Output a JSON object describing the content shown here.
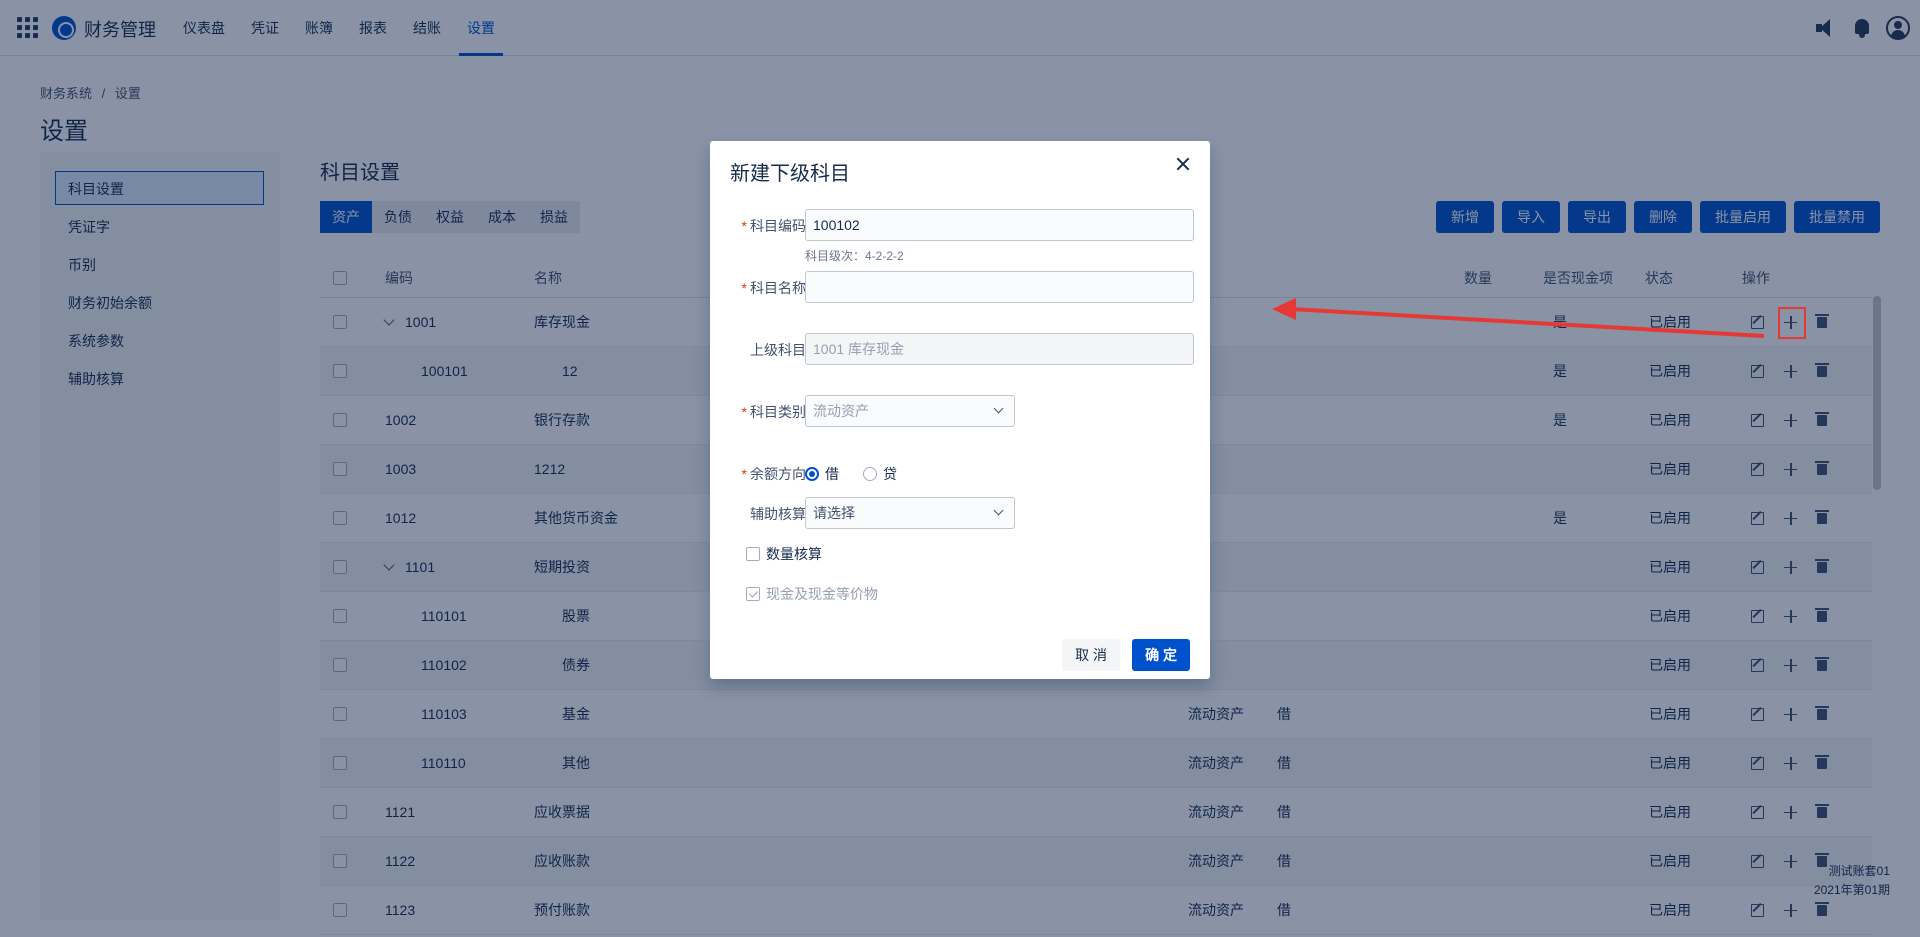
{
  "app": {
    "title": "财务管理"
  },
  "nav": [
    "仪表盘",
    "凭证",
    "账簿",
    "报表",
    "结账",
    "设置"
  ],
  "nav_active": 5,
  "breadcrumb": [
    "财务系统",
    "/",
    "设置"
  ],
  "page_title": "设置",
  "sidebar": {
    "items": [
      "科目设置",
      "凭证字",
      "币别",
      "财务初始余额",
      "系统参数",
      "辅助核算"
    ],
    "active": 0
  },
  "content": {
    "title": "科目设置",
    "tabs": [
      "资产",
      "负债",
      "权益",
      "成本",
      "损益"
    ],
    "active_tab": 0,
    "actions": [
      "新增",
      "导入",
      "导出",
      "删除",
      "批量启用",
      "批量禁用"
    ]
  },
  "table": {
    "columns": {
      "code": "编码",
      "name": "名称",
      "qty": "数量",
      "cash": "是否现金项",
      "status": "状态",
      "ops": "操作"
    },
    "rows": [
      {
        "code": "1001",
        "name": "库存现金",
        "type": "",
        "dir": "",
        "cash": "是",
        "status": "已启用",
        "expand": true,
        "indent": false
      },
      {
        "code": "100101",
        "name": "12",
        "type": "",
        "dir": "",
        "cash": "是",
        "status": "已启用",
        "expand": false,
        "indent": true
      },
      {
        "code": "1002",
        "name": "银行存款",
        "type": "",
        "dir": "",
        "cash": "是",
        "status": "已启用",
        "expand": false,
        "indent": false
      },
      {
        "code": "1003",
        "name": "1212",
        "type": "",
        "dir": "",
        "cash": "",
        "status": "已启用",
        "expand": false,
        "indent": false
      },
      {
        "code": "1012",
        "name": "其他货币资金",
        "type": "",
        "dir": "",
        "cash": "是",
        "status": "已启用",
        "expand": false,
        "indent": false
      },
      {
        "code": "1101",
        "name": "短期投资",
        "type": "",
        "dir": "",
        "cash": "",
        "status": "已启用",
        "expand": true,
        "indent": false
      },
      {
        "code": "110101",
        "name": "股票",
        "type": "",
        "dir": "",
        "cash": "",
        "status": "已启用",
        "expand": false,
        "indent": true
      },
      {
        "code": "110102",
        "name": "债券",
        "type": "",
        "dir": "",
        "cash": "",
        "status": "已启用",
        "expand": false,
        "indent": true
      },
      {
        "code": "110103",
        "name": "基金",
        "type": "流动资产",
        "dir": "借",
        "cash": "",
        "status": "已启用",
        "expand": false,
        "indent": true
      },
      {
        "code": "110110",
        "name": "其他",
        "type": "流动资产",
        "dir": "借",
        "cash": "",
        "status": "已启用",
        "expand": false,
        "indent": true
      },
      {
        "code": "1121",
        "name": "应收票据",
        "type": "流动资产",
        "dir": "借",
        "cash": "",
        "status": "已启用",
        "expand": false,
        "indent": false
      },
      {
        "code": "1122",
        "name": "应收账款",
        "type": "流动资产",
        "dir": "借",
        "cash": "",
        "status": "已启用",
        "expand": false,
        "indent": false
      },
      {
        "code": "1123",
        "name": "预付账款",
        "type": "流动资产",
        "dir": "借",
        "cash": "",
        "status": "已启用",
        "expand": false,
        "indent": false
      }
    ]
  },
  "footer": {
    "account": "测试账套01",
    "period": "2021年第01期"
  },
  "modal": {
    "title": "新建下级科目",
    "code_label": "科目编码",
    "code_value": "100102",
    "code_hint": "科目级次：4-2-2-2",
    "name_label": "科目名称",
    "name_value": "",
    "parent_label": "上级科目",
    "parent_value": "1001 库存现金",
    "category_label": "科目类别",
    "category_value": "流动资产",
    "direction_label": "余额方向",
    "direction_debit": "借",
    "direction_credit": "贷",
    "aux_label": "辅助核算",
    "aux_placeholder": "请选择",
    "qty_check": "数量核算",
    "cash_check": "现金及现金等价物",
    "cancel": "取 消",
    "ok": "确 定"
  },
  "colors": {
    "primary": "#0052cc",
    "annotation": "#e53935"
  }
}
